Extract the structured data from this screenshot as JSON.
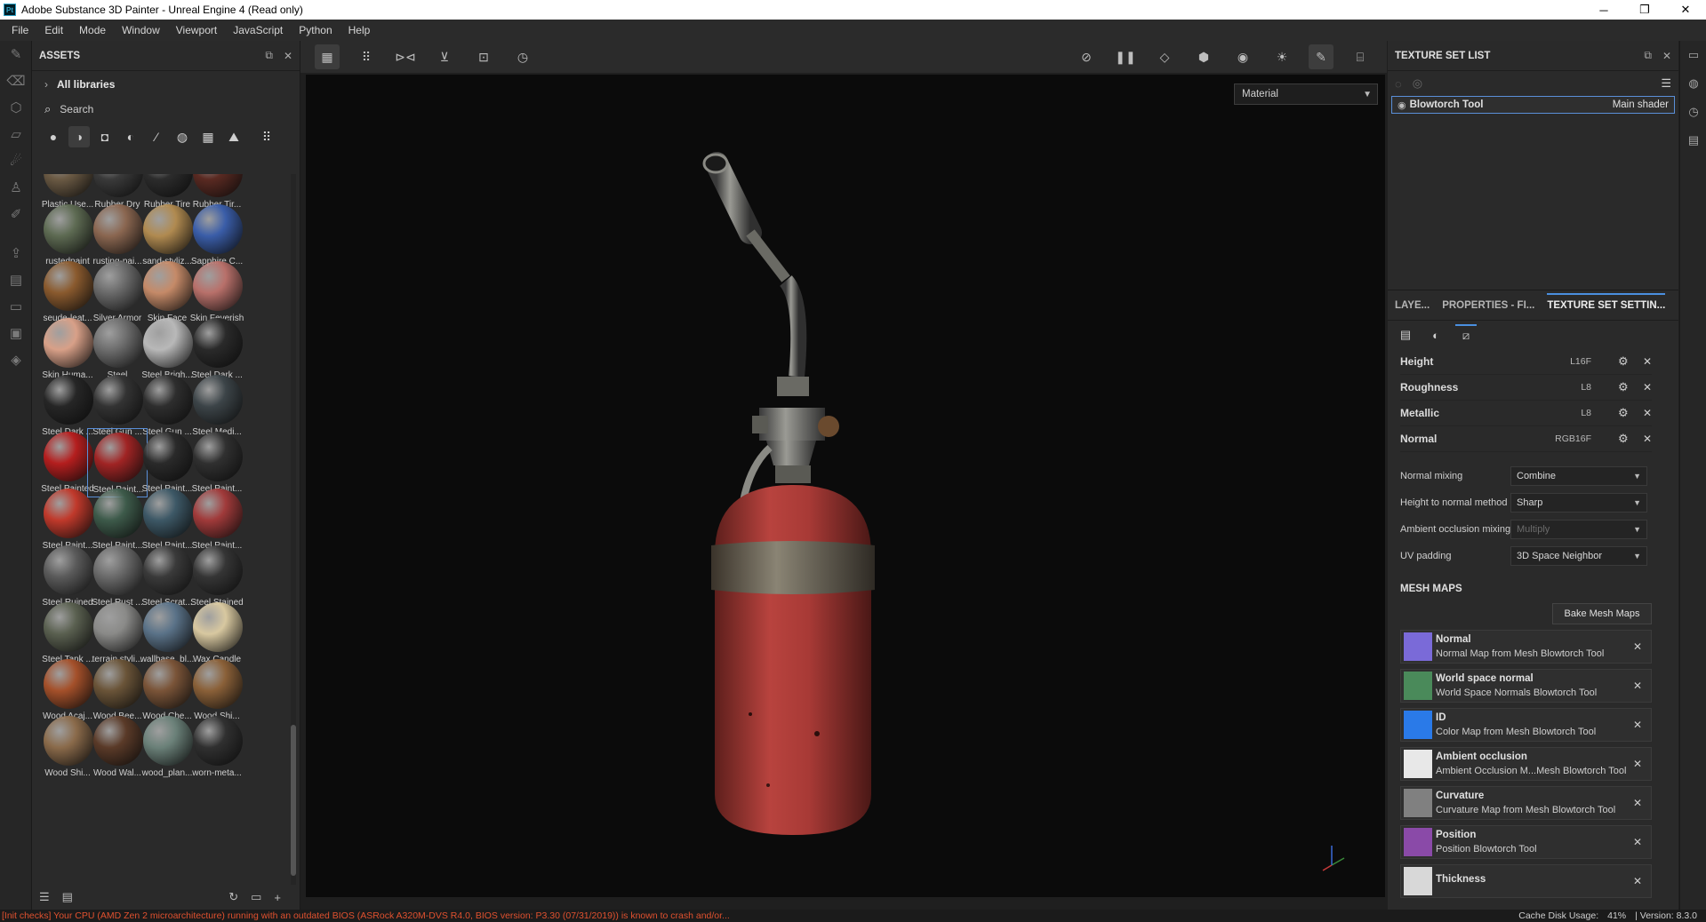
{
  "window": {
    "title": "Adobe Substance 3D Painter - Unreal Engine 4 (Read only)",
    "app_icon": "Pt",
    "controls": [
      "─",
      "❐",
      "✕"
    ]
  },
  "menu": [
    "File",
    "Edit",
    "Mode",
    "Window",
    "Viewport",
    "JavaScript",
    "Python",
    "Help"
  ],
  "assets": {
    "title": "ASSETS",
    "library": "All libraries",
    "search": "Search",
    "items": [
      {
        "label": "Plastic Use...",
        "color": "#6b5a44"
      },
      {
        "label": "Rubber Dry",
        "color": "#3a3a3a"
      },
      {
        "label": "Rubber Tire",
        "color": "#2c2c2c"
      },
      {
        "label": "Rubber Tir...",
        "color": "#5a2a22"
      },
      {
        "label": "rustedpaint",
        "color": "#5d6a52"
      },
      {
        "label": "rusting-pai...",
        "color": "#8a6650"
      },
      {
        "label": "sand-styliz...",
        "color": "#b08a50"
      },
      {
        "label": "Sapphire C...",
        "color": "#3a5da8"
      },
      {
        "label": "seude-leat...",
        "color": "#8a5a2e"
      },
      {
        "label": "Silver Armor",
        "color": "#6a6a6a"
      },
      {
        "label": "Skin Face",
        "color": "#c58a68"
      },
      {
        "label": "Skin Feverish",
        "color": "#b8706a"
      },
      {
        "label": "Skin Huma...",
        "color": "#d8a088"
      },
      {
        "label": "Steel",
        "color": "#6e6e6e"
      },
      {
        "label": "Steel Brigh...",
        "color": "#b8b8b8"
      },
      {
        "label": "Steel Dark ...",
        "color": "#2a2a2a"
      },
      {
        "label": "Steel Dark ...",
        "color": "#262626"
      },
      {
        "label": "Steel Gun ...",
        "color": "#333333"
      },
      {
        "label": "Steel Gun ...",
        "color": "#2e2e2e"
      },
      {
        "label": "Steel Medi...",
        "color": "#3c4448"
      },
      {
        "label": "Steel Painted",
        "color": "#b41e1e"
      },
      {
        "label": "Steel Paint...",
        "color": "#a02424"
      },
      {
        "label": "Steel Paint...",
        "color": "#2a2a2a"
      },
      {
        "label": "Steel Paint...",
        "color": "#303030"
      },
      {
        "label": "Steel Paint...",
        "color": "#c0392b"
      },
      {
        "label": "Steel Paint...",
        "color": "#3d5a4a"
      },
      {
        "label": "Steel Paint...",
        "color": "#3d5866"
      },
      {
        "label": "Steel Paint...",
        "color": "#a03a3a"
      },
      {
        "label": "Steel Ruined",
        "color": "#5a5a5a"
      },
      {
        "label": "Steel Rust ...",
        "color": "#6a6a6a"
      },
      {
        "label": "Steel Scrat...",
        "color": "#3a3a3a"
      },
      {
        "label": "Steel Stained",
        "color": "#353535"
      },
      {
        "label": "Steel Tank ...",
        "color": "#5a6050"
      },
      {
        "label": "terrain styli...",
        "color": "#8a8a88"
      },
      {
        "label": "wallbase_bl...",
        "color": "#5a7288"
      },
      {
        "label": "Wax Candle",
        "color": "#d8c8a0"
      },
      {
        "label": "Wood Acaj...",
        "color": "#a4502a"
      },
      {
        "label": "Wood Bee...",
        "color": "#6a5438"
      },
      {
        "label": "Wood Che...",
        "color": "#7a5438"
      },
      {
        "label": "Wood Shi...",
        "color": "#8a6038"
      },
      {
        "label": "Wood Shi...",
        "color": "#8a6a4a"
      },
      {
        "label": "Wood Wal...",
        "color": "#5a3a28"
      },
      {
        "label": "wood_plan...",
        "color": "#6a8078"
      },
      {
        "label": "worn-meta...",
        "color": "#303030"
      }
    ],
    "selected_index": 21
  },
  "viewport": {
    "mode_select": "Material"
  },
  "texture_set_list": {
    "title": "TEXTURE SET LIST",
    "item_name": "Blowtorch Tool",
    "item_shader": "Main shader"
  },
  "tss": {
    "tabs": [
      "LAYE...",
      "PROPERTIES - FI...",
      "TEXTURE SET SETTIN..."
    ],
    "channels": [
      {
        "name": "Height",
        "format": "L16F"
      },
      {
        "name": "Roughness",
        "format": "L8"
      },
      {
        "name": "Metallic",
        "format": "L8"
      },
      {
        "name": "Normal",
        "format": "RGB16F"
      }
    ],
    "settings": [
      {
        "label": "Normal mixing",
        "value": "Combine",
        "disabled": false
      },
      {
        "label": "Height to normal method",
        "value": "Sharp",
        "disabled": false
      },
      {
        "label": "Ambient occlusion mixing",
        "value": "Multiply",
        "disabled": true
      },
      {
        "label": "UV padding",
        "value": "3D Space Neighbor",
        "disabled": false
      }
    ],
    "mesh_maps_title": "MESH MAPS",
    "bake_button": "Bake Mesh Maps",
    "mesh_maps": [
      {
        "name": "Normal",
        "desc": "Normal Map from Mesh Blowtorch Tool",
        "thumb": "#7a6ad8"
      },
      {
        "name": "World space normal",
        "desc": "World Space Normals Blowtorch Tool",
        "thumb": "#4a8a5a"
      },
      {
        "name": "ID",
        "desc": "Color Map from Mesh Blowtorch Tool",
        "thumb": "#2a7ae8"
      },
      {
        "name": "Ambient occlusion",
        "desc": "Ambient Occlusion M...Mesh Blowtorch Tool",
        "thumb": "#e8e8e8"
      },
      {
        "name": "Curvature",
        "desc": "Curvature Map from Mesh Blowtorch Tool",
        "thumb": "#808080"
      },
      {
        "name": "Position",
        "desc": "Position Blowtorch Tool",
        "thumb": "#8a4aa8"
      },
      {
        "name": "Thickness",
        "desc": "",
        "thumb": "#d8d8d8"
      }
    ]
  },
  "status": {
    "warning": "[Init checks] Your CPU (AMD Zen 2 microarchitecture) running with an outdated BIOS (ASRock A320M-DVS R4.0, BIOS version: P3.30 (07/31/2019)) is known to crash and/or...",
    "cache_label": "Cache Disk Usage:",
    "cache_value": "41%",
    "version": "| Version: 8.3.0"
  },
  "colors": {
    "accent": "#4a8fe0",
    "warning": "#e0512f",
    "tank_red": "#b8433e"
  }
}
